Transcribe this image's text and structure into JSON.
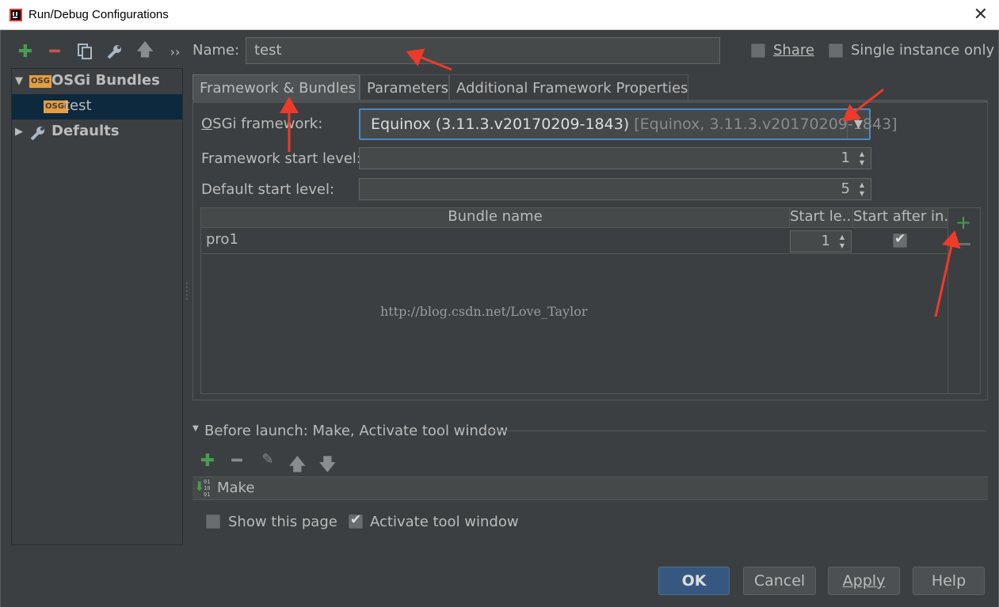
{
  "window": {
    "title": "Run/Debug Configurations",
    "close_glyph": "✕"
  },
  "toolbar": {
    "more_glyph": "››"
  },
  "tree": {
    "items": [
      {
        "label": "OSGi Bundles",
        "icon_text": "OSG"
      },
      {
        "label": "test",
        "icon_text": "OSGi"
      },
      {
        "label": "Defaults"
      }
    ]
  },
  "name": {
    "label": "Name:",
    "value": "test"
  },
  "share": {
    "label": "Share",
    "checked": false
  },
  "single_instance": {
    "label": "Single instance only",
    "checked": false
  },
  "tabs": [
    {
      "label": "Framework & Bundles",
      "active": true
    },
    {
      "label": "Parameters",
      "active": false
    },
    {
      "label": "Additional Framework Properties",
      "active": false
    }
  ],
  "framework": {
    "label": "OSGi framework:",
    "value": "Equinox (3.11.3.v20170209-1843)",
    "hint": "[Equinox, 3.11.3.v20170209-1843]"
  },
  "framework_start_level": {
    "label": "Framework start level:",
    "value": "1"
  },
  "default_start_level": {
    "label": "Default start level:",
    "value": "5"
  },
  "bundles_table": {
    "columns": [
      "Bundle name",
      "Start le...",
      "Start after in..."
    ],
    "rows": [
      {
        "name": "pro1",
        "start_level": "1",
        "start_after_install": true
      }
    ]
  },
  "watermark": "http://blog.csdn.net/Love_Taylor",
  "before_launch": {
    "title": "Before launch: Make, Activate tool window",
    "items": [
      {
        "label": "Make"
      }
    ]
  },
  "show_this_page": {
    "label": "Show this page",
    "checked": false
  },
  "activate_tool_window": {
    "label": "Activate tool window",
    "checked": true
  },
  "buttons": {
    "ok": "OK",
    "cancel": "Cancel",
    "apply": "Apply",
    "help": "Help"
  },
  "colors": {
    "background": "#3c3f41",
    "selection": "#0d293e",
    "focus_border": "#4a88c7",
    "green_icon": "#499c54",
    "red_icon": "#c75450",
    "osgi_badge": "#e69c3f",
    "annotation_arrow": "#ee3a2a"
  }
}
